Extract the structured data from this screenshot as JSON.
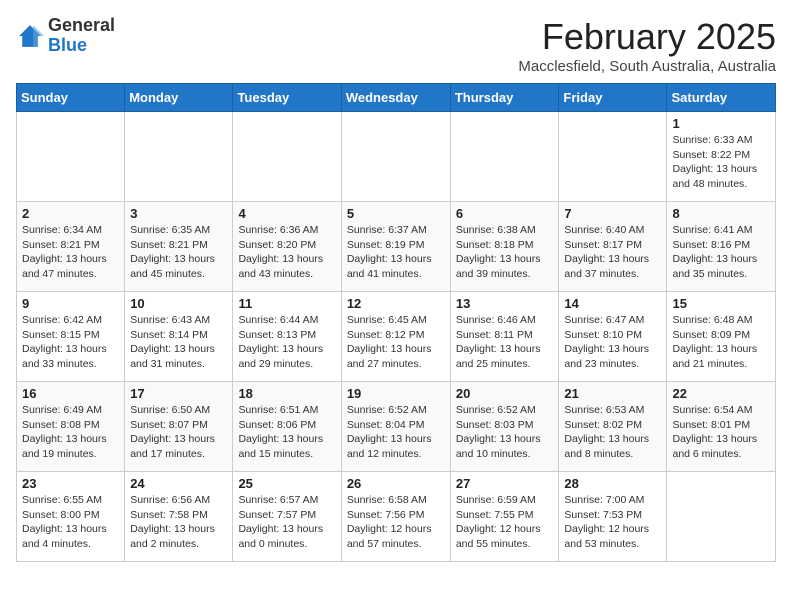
{
  "header": {
    "logo_general": "General",
    "logo_blue": "Blue",
    "title": "February 2025",
    "subtitle": "Macclesfield, South Australia, Australia"
  },
  "weekdays": [
    "Sunday",
    "Monday",
    "Tuesday",
    "Wednesday",
    "Thursday",
    "Friday",
    "Saturday"
  ],
  "weeks": [
    [
      {
        "day": "",
        "info": ""
      },
      {
        "day": "",
        "info": ""
      },
      {
        "day": "",
        "info": ""
      },
      {
        "day": "",
        "info": ""
      },
      {
        "day": "",
        "info": ""
      },
      {
        "day": "",
        "info": ""
      },
      {
        "day": "1",
        "info": "Sunrise: 6:33 AM\nSunset: 8:22 PM\nDaylight: 13 hours\nand 48 minutes."
      }
    ],
    [
      {
        "day": "2",
        "info": "Sunrise: 6:34 AM\nSunset: 8:21 PM\nDaylight: 13 hours\nand 47 minutes."
      },
      {
        "day": "3",
        "info": "Sunrise: 6:35 AM\nSunset: 8:21 PM\nDaylight: 13 hours\nand 45 minutes."
      },
      {
        "day": "4",
        "info": "Sunrise: 6:36 AM\nSunset: 8:20 PM\nDaylight: 13 hours\nand 43 minutes."
      },
      {
        "day": "5",
        "info": "Sunrise: 6:37 AM\nSunset: 8:19 PM\nDaylight: 13 hours\nand 41 minutes."
      },
      {
        "day": "6",
        "info": "Sunrise: 6:38 AM\nSunset: 8:18 PM\nDaylight: 13 hours\nand 39 minutes."
      },
      {
        "day": "7",
        "info": "Sunrise: 6:40 AM\nSunset: 8:17 PM\nDaylight: 13 hours\nand 37 minutes."
      },
      {
        "day": "8",
        "info": "Sunrise: 6:41 AM\nSunset: 8:16 PM\nDaylight: 13 hours\nand 35 minutes."
      }
    ],
    [
      {
        "day": "9",
        "info": "Sunrise: 6:42 AM\nSunset: 8:15 PM\nDaylight: 13 hours\nand 33 minutes."
      },
      {
        "day": "10",
        "info": "Sunrise: 6:43 AM\nSunset: 8:14 PM\nDaylight: 13 hours\nand 31 minutes."
      },
      {
        "day": "11",
        "info": "Sunrise: 6:44 AM\nSunset: 8:13 PM\nDaylight: 13 hours\nand 29 minutes."
      },
      {
        "day": "12",
        "info": "Sunrise: 6:45 AM\nSunset: 8:12 PM\nDaylight: 13 hours\nand 27 minutes."
      },
      {
        "day": "13",
        "info": "Sunrise: 6:46 AM\nSunset: 8:11 PM\nDaylight: 13 hours\nand 25 minutes."
      },
      {
        "day": "14",
        "info": "Sunrise: 6:47 AM\nSunset: 8:10 PM\nDaylight: 13 hours\nand 23 minutes."
      },
      {
        "day": "15",
        "info": "Sunrise: 6:48 AM\nSunset: 8:09 PM\nDaylight: 13 hours\nand 21 minutes."
      }
    ],
    [
      {
        "day": "16",
        "info": "Sunrise: 6:49 AM\nSunset: 8:08 PM\nDaylight: 13 hours\nand 19 minutes."
      },
      {
        "day": "17",
        "info": "Sunrise: 6:50 AM\nSunset: 8:07 PM\nDaylight: 13 hours\nand 17 minutes."
      },
      {
        "day": "18",
        "info": "Sunrise: 6:51 AM\nSunset: 8:06 PM\nDaylight: 13 hours\nand 15 minutes."
      },
      {
        "day": "19",
        "info": "Sunrise: 6:52 AM\nSunset: 8:04 PM\nDaylight: 13 hours\nand 12 minutes."
      },
      {
        "day": "20",
        "info": "Sunrise: 6:52 AM\nSunset: 8:03 PM\nDaylight: 13 hours\nand 10 minutes."
      },
      {
        "day": "21",
        "info": "Sunrise: 6:53 AM\nSunset: 8:02 PM\nDaylight: 13 hours\nand 8 minutes."
      },
      {
        "day": "22",
        "info": "Sunrise: 6:54 AM\nSunset: 8:01 PM\nDaylight: 13 hours\nand 6 minutes."
      }
    ],
    [
      {
        "day": "23",
        "info": "Sunrise: 6:55 AM\nSunset: 8:00 PM\nDaylight: 13 hours\nand 4 minutes."
      },
      {
        "day": "24",
        "info": "Sunrise: 6:56 AM\nSunset: 7:58 PM\nDaylight: 13 hours\nand 2 minutes."
      },
      {
        "day": "25",
        "info": "Sunrise: 6:57 AM\nSunset: 7:57 PM\nDaylight: 13 hours\nand 0 minutes."
      },
      {
        "day": "26",
        "info": "Sunrise: 6:58 AM\nSunset: 7:56 PM\nDaylight: 12 hours\nand 57 minutes."
      },
      {
        "day": "27",
        "info": "Sunrise: 6:59 AM\nSunset: 7:55 PM\nDaylight: 12 hours\nand 55 minutes."
      },
      {
        "day": "28",
        "info": "Sunrise: 7:00 AM\nSunset: 7:53 PM\nDaylight: 12 hours\nand 53 minutes."
      },
      {
        "day": "",
        "info": ""
      }
    ]
  ]
}
